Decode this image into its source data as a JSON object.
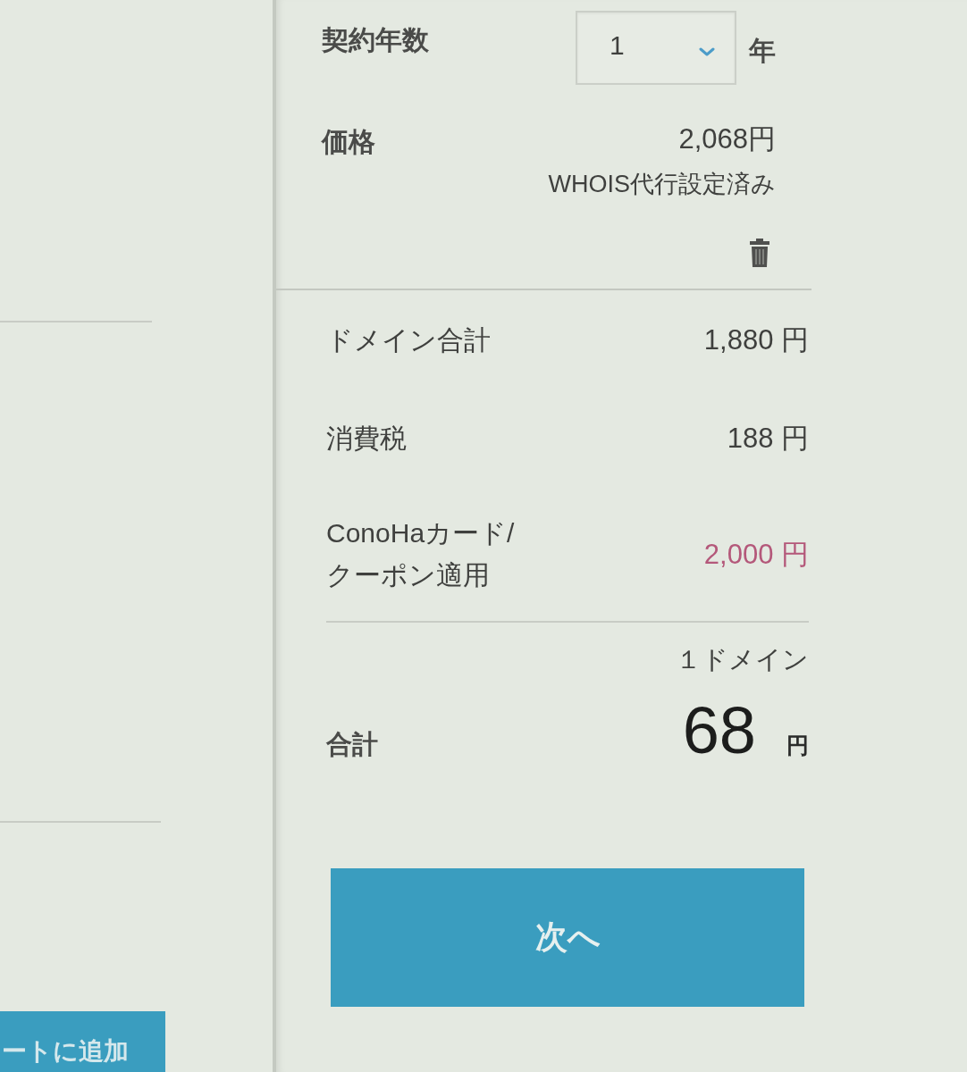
{
  "left_panel": {
    "button": {
      "label": "ートに追加"
    }
  },
  "order_summary": {
    "term": {
      "label": "契約年数",
      "value": "1",
      "unit": "年"
    },
    "price": {
      "label": "価格",
      "value": "2,068円",
      "note": "WHOIS代行設定済み"
    },
    "lines": [
      {
        "label": "ドメイン合計",
        "value": "1,880 円",
        "kind": "amount"
      },
      {
        "label": "消費税",
        "value": "188 円",
        "kind": "amount"
      },
      {
        "label": "ConoHaカード/クーポン適用",
        "value": "2,000 円",
        "kind": "discount"
      }
    ],
    "total": {
      "count": "１ドメイン",
      "label": "合計",
      "value": "68",
      "unit": "円"
    },
    "next_button": {
      "label": "次へ"
    }
  }
}
